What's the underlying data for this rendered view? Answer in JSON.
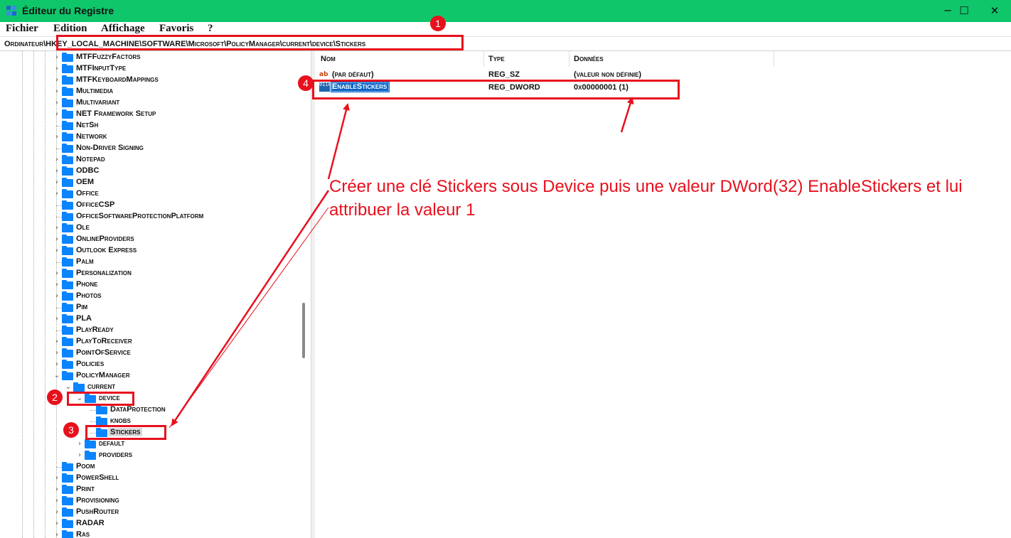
{
  "window": {
    "title": "Éditeur du Registre",
    "minimize_glyph": "─",
    "maximize_glyph": "☐",
    "close_glyph": "✕"
  },
  "menu": [
    "Fichier",
    "Edition",
    "Affichage",
    "Favoris",
    "?"
  ],
  "address": "Ordinateur\\HKEY_LOCAL_MACHINE\\SOFTWARE\\Microsoft\\PolicyManager\\current\\device\\Stickers",
  "tree": [
    {
      "label": "MTFFuzzyFactors",
      "expand": "›"
    },
    {
      "label": "MTFInputType",
      "expand": "›"
    },
    {
      "label": "MTFKeyboardMappings",
      "expand": "›"
    },
    {
      "label": "Multimedia",
      "expand": "›"
    },
    {
      "label": "Multivariant",
      "expand": "›"
    },
    {
      "label": "NET Framework Setup",
      "expand": "›"
    },
    {
      "label": "NetSh",
      "expand": ""
    },
    {
      "label": "Network",
      "expand": "›"
    },
    {
      "label": "Non-Driver Signing",
      "expand": ""
    },
    {
      "label": "Notepad",
      "expand": "›"
    },
    {
      "label": "ODBC",
      "expand": "›"
    },
    {
      "label": "OEM",
      "expand": "›"
    },
    {
      "label": "Office",
      "expand": "›"
    },
    {
      "label": "OfficeCSP",
      "expand": ""
    },
    {
      "label": "OfficeSoftwareProtectionPlatform",
      "expand": ""
    },
    {
      "label": "Ole",
      "expand": "›"
    },
    {
      "label": "OnlineProviders",
      "expand": "›"
    },
    {
      "label": "Outlook Express",
      "expand": "›"
    },
    {
      "label": "Palm",
      "expand": ""
    },
    {
      "label": "Personalization",
      "expand": "›"
    },
    {
      "label": "Phone",
      "expand": "›"
    },
    {
      "label": "Photos",
      "expand": "›"
    },
    {
      "label": "Pim",
      "expand": ""
    },
    {
      "label": "PLA",
      "expand": "›"
    },
    {
      "label": "PlayReady",
      "expand": ""
    },
    {
      "label": "PlayToReceiver",
      "expand": "›"
    },
    {
      "label": "PointOfService",
      "expand": "›"
    },
    {
      "label": "Policies",
      "expand": "›"
    },
    {
      "label": "PolicyManager",
      "expand": "⌄"
    },
    {
      "label": "current",
      "expand": "⌄"
    },
    {
      "label": "device",
      "expand": "⌄"
    },
    {
      "label": "DataProtection",
      "expand": ""
    },
    {
      "label": "knobs",
      "expand": ""
    },
    {
      "label": "Stickers",
      "expand": ""
    },
    {
      "label": "default",
      "expand": "›"
    },
    {
      "label": "providers",
      "expand": "›"
    },
    {
      "label": "Poom",
      "expand": ""
    },
    {
      "label": "PowerShell",
      "expand": "›"
    },
    {
      "label": "Print",
      "expand": "›"
    },
    {
      "label": "Provisioning",
      "expand": "›"
    },
    {
      "label": "PushRouter",
      "expand": "›"
    },
    {
      "label": "RADAR",
      "expand": "›"
    },
    {
      "label": "Ras",
      "expand": "›"
    }
  ],
  "list": {
    "headers": {
      "name": "Nom",
      "type": "Type",
      "data": "Données"
    },
    "rows": [
      {
        "icon": "ab",
        "name": "(par défaut)",
        "type": "REG_SZ",
        "data": "(valeur non définie)"
      },
      {
        "icon": "0110",
        "name": "EnableStickers",
        "type": "REG_DWORD",
        "data": "0x00000001 (1)"
      }
    ]
  },
  "annotations": {
    "steps": [
      "1",
      "2",
      "3",
      "4"
    ],
    "text": "Créer une clé Stickers sous Device puis une valeur DWord(32) EnableStickers et lui attribuer la valeur 1",
    "color": "#e8101d"
  }
}
